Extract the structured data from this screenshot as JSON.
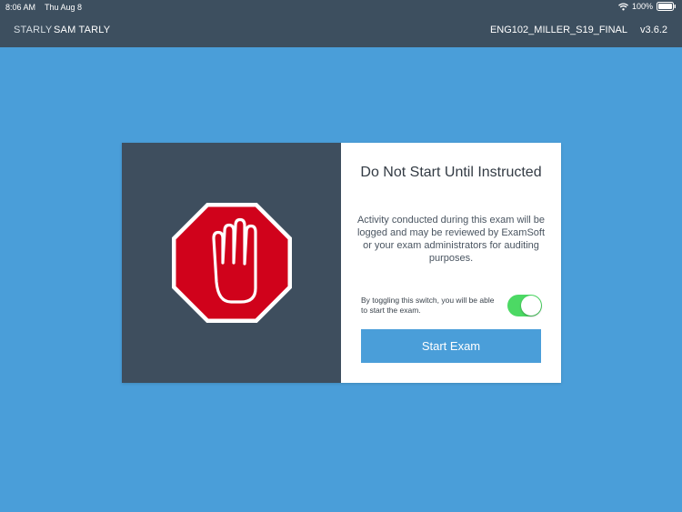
{
  "status_bar": {
    "time": "8:06 AM",
    "date": "Thu Aug 8",
    "battery": "100%",
    "wifi_icon": "wifi-icon",
    "battery_icon": "battery-icon"
  },
  "header": {
    "user_short": "STARLY",
    "user_full": "SAM TARLY",
    "exam_code": "ENG102_MILLER_S19_FINAL",
    "version": "v3.6.2"
  },
  "dialog": {
    "icon": "stop-hand-icon",
    "title": "Do Not Start Until Instructed",
    "message": "Activity conducted during this exam will be logged and may be reviewed by ExamSoft or your exam administrators for auditing purposes.",
    "toggle_label": "By toggling this switch, you will be able to start the exam.",
    "toggle_on": true,
    "start_button": "Start Exam"
  },
  "colors": {
    "background": "#4a9ed9",
    "header": "#3d4f5f",
    "panel_dark": "#3e4e5e",
    "stop_red": "#d0021b",
    "toggle_on": "#4cd964",
    "button": "#4a9ed9"
  }
}
